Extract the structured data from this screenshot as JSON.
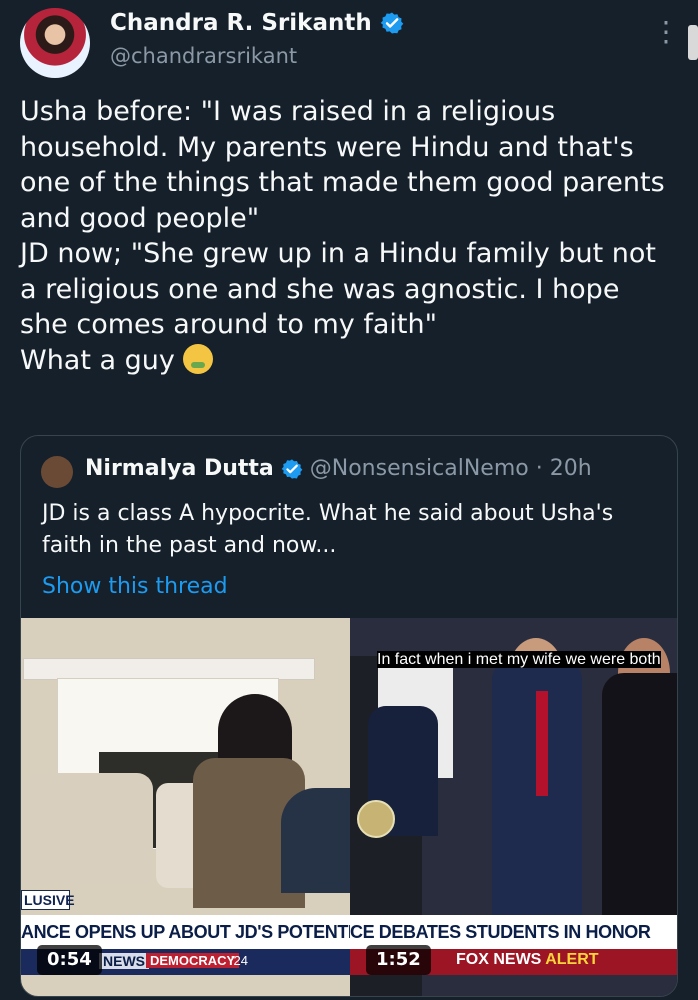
{
  "author": {
    "name": "Chandra R. Srikanth",
    "handle": "@chandrarsrikant"
  },
  "tweet": {
    "text": "Usha before: \"I was raised in a religious household. My parents were Hindu and that's one of the things that made them good parents and good people\"\nJD now; \"She grew up in a Hindu family but not a religious one and she was agnostic. I hope she comes around to my faith\"\nWhat a guy",
    "emoji": "nauseated-face-icon"
  },
  "quoted_tweet": {
    "name": "Nirmalya Dutta",
    "handle": "@NonsensicalNemo",
    "time": "20h",
    "text": "JD is a class A hypocrite. What he said about Usha's faith in the past and now...",
    "show_thread": "Show this thread"
  },
  "media": [
    {
      "duration": "0:54",
      "exclusive_label": "LUSIVE",
      "headline": "ANCE OPENS UP ABOUT JD'S POTENTIAL AS VE",
      "ticker_news": "NEWS",
      "ticker_democracy": "DEMOCRACY",
      "ticker_year": "'24"
    },
    {
      "duration": "1:52",
      "caption": "In fact when i met my wife we were both",
      "headline": "CE DEBATES STUDENTS IN HONOR",
      "ticker_brand": "FOX NEWS",
      "ticker_alert": "ALERT"
    }
  ],
  "colors": {
    "background": "#15202b",
    "link": "#1d9bf0",
    "verified": "#1d9bf0",
    "muted": "#8b98a5"
  }
}
